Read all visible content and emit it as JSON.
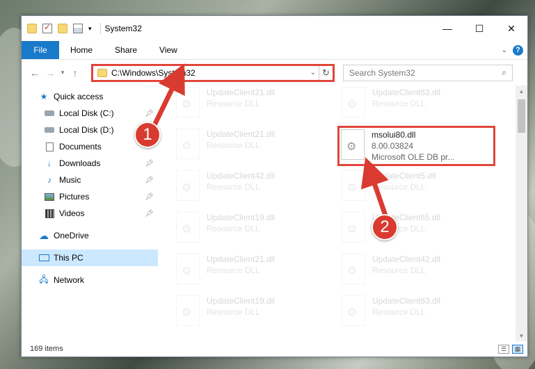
{
  "window": {
    "title": "System32",
    "controls": {
      "minimize": "—",
      "maximize": "☐",
      "close": "✕"
    }
  },
  "ribbon": {
    "file_tab": "File",
    "tabs": [
      "Home",
      "Share",
      "View"
    ]
  },
  "address_bar": {
    "path": "C:\\Windows\\System32",
    "search_placeholder": "Search System32"
  },
  "nav_pane": {
    "items": [
      {
        "label": "Quick access",
        "icon": "star-icon"
      },
      {
        "label": "Local Disk (C:)",
        "icon": "disk-icon",
        "pinned": true
      },
      {
        "label": "Local Disk (D:)",
        "icon": "disk-icon"
      },
      {
        "label": "Documents",
        "icon": "documents-icon"
      },
      {
        "label": "Downloads",
        "icon": "downloads-icon",
        "pinned": true
      },
      {
        "label": "Music",
        "icon": "music-icon",
        "pinned": true
      },
      {
        "label": "Pictures",
        "icon": "pictures-icon",
        "pinned": true
      },
      {
        "label": "Videos",
        "icon": "videos-icon",
        "pinned": true
      },
      {
        "label": "OneDrive",
        "icon": "cloud-icon"
      },
      {
        "label": "This PC",
        "icon": "computer-icon",
        "selected": true
      },
      {
        "label": "Network",
        "icon": "network-icon"
      }
    ]
  },
  "files": {
    "left_column": [
      {
        "name": "UpdateClient21.dll",
        "type": "Resource DLL"
      },
      {
        "name": "UpdateClient21.dll",
        "type": "Resource DLL"
      },
      {
        "name": "UpdateClient42.dll",
        "type": "Resource DLL"
      },
      {
        "name": "UpdateClient19.dll",
        "type": "Resource DLL"
      },
      {
        "name": "UpdateClient21.dll",
        "type": "Resource DLL"
      },
      {
        "name": "UpdateClient19.dll",
        "type": "Resource DLL"
      }
    ],
    "right_column": [
      {
        "name": "UpdateClient63.dll",
        "type": "Resource DLL"
      },
      {
        "name": "msolui80.dll",
        "version": "8.00.03824",
        "type": "Microsoft OLE DB pr...",
        "highlighted": true
      },
      {
        "name": "UpdateClient5.dll",
        "type": "Resource DLL"
      },
      {
        "name": "UpdateClient65.dll",
        "type": "Resource DLL"
      },
      {
        "name": "UpdateClient42.dll",
        "type": "Resource DLL"
      },
      {
        "name": "UpdateClient63.dll",
        "type": "Resource DLL"
      }
    ]
  },
  "status_bar": {
    "item_count": "169 items"
  },
  "annotations": {
    "step1": "1",
    "step2": "2",
    "color": "#d93b30"
  },
  "colors": {
    "accent": "#1979ca",
    "highlight_border": "#e0453a"
  }
}
